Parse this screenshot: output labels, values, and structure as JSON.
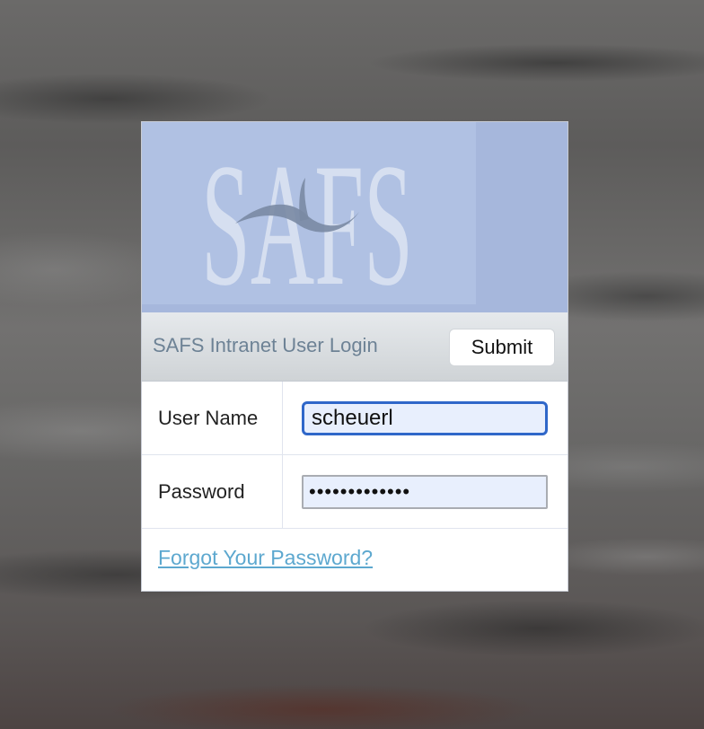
{
  "logo": {
    "text": "SAFS",
    "icon": "safs-wave-logo"
  },
  "header": {
    "title": "SAFS Intranet User Login",
    "submit_label": "Submit"
  },
  "form": {
    "username": {
      "label": "User Name",
      "value": "scheuerl"
    },
    "password": {
      "label": "Password",
      "value": "•••••••••••••"
    }
  },
  "links": {
    "forgot_password": "Forgot Your Password?"
  },
  "colors": {
    "banner": "#a6b7dc",
    "header_title": "#6d8295",
    "link": "#5da8cf",
    "focus_border": "#2f67c9",
    "input_bg": "#e8effd"
  }
}
